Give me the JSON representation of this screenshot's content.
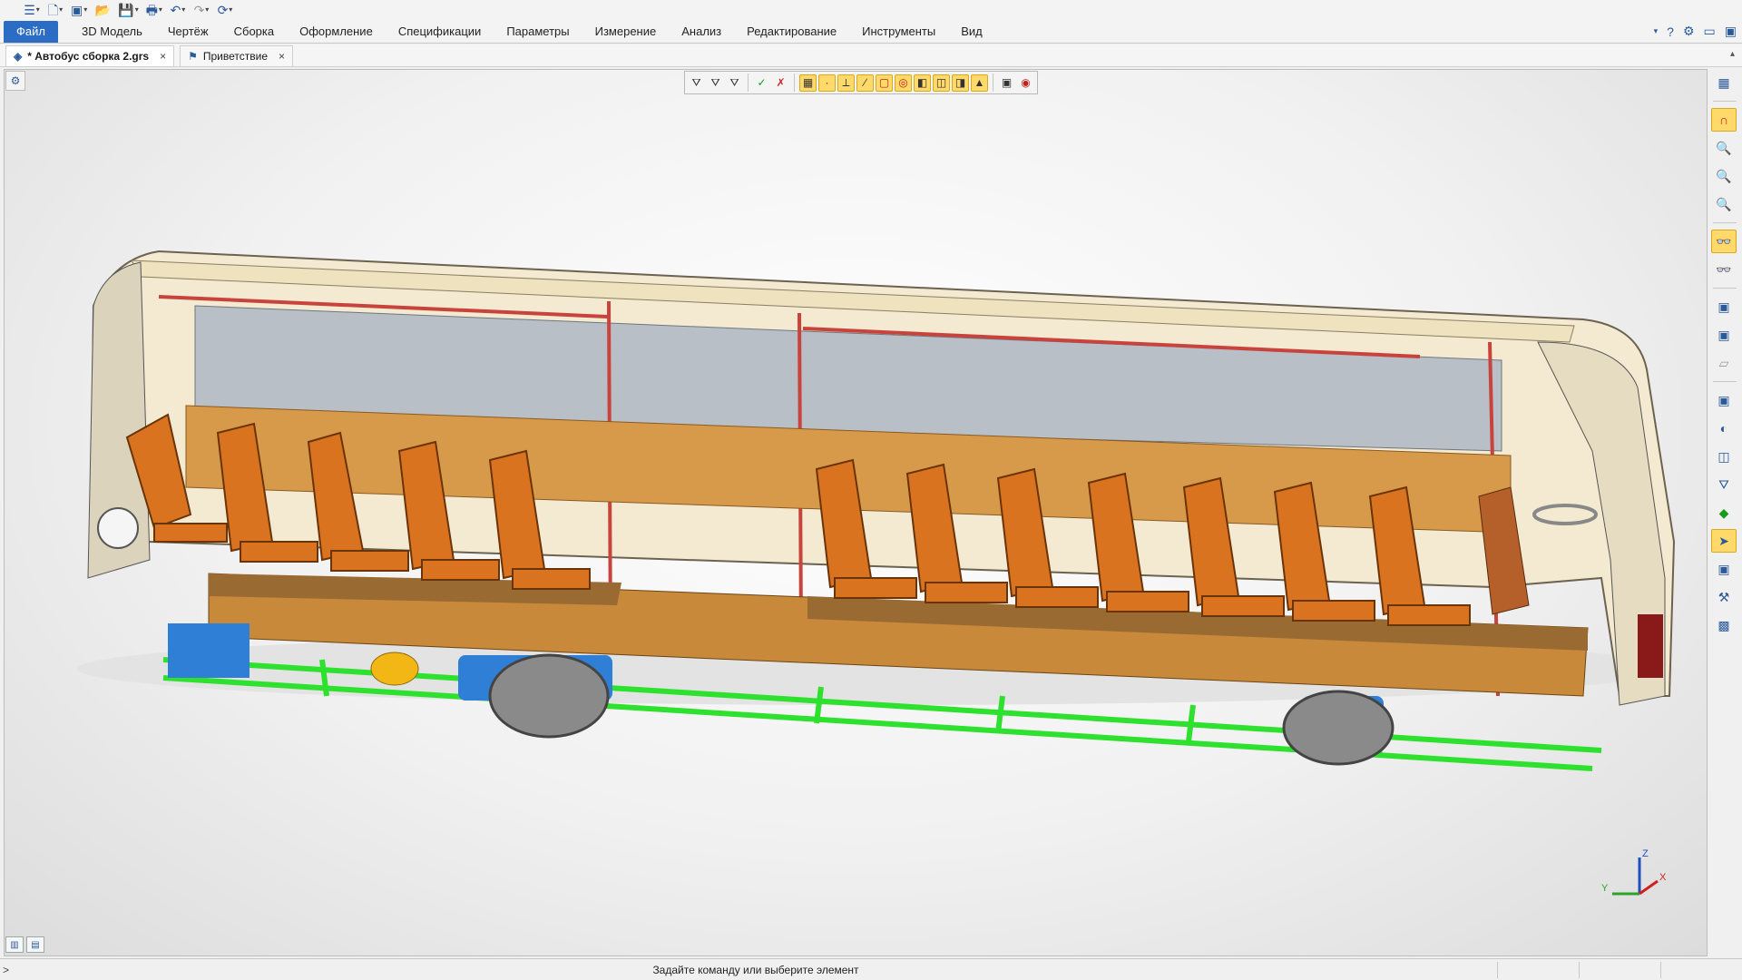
{
  "quick_access": {
    "icons": [
      "menu-icon",
      "new-document-icon",
      "new-document-dropdown",
      "model-icon",
      "open-folder-icon",
      "save-icon",
      "print-icon",
      "undo-icon",
      "redo-icon",
      "regenerate-icon"
    ]
  },
  "menu": {
    "file": "Файл",
    "items": [
      "3D Модель",
      "Чертёж",
      "Сборка",
      "Оформление",
      "Спецификации",
      "Параметры",
      "Измерение",
      "Анализ",
      "Редактирование",
      "Инструменты",
      "Вид"
    ]
  },
  "tabs": [
    {
      "label": "* Автобус сборка 2.grs",
      "close": "×",
      "active": true
    },
    {
      "label": "Приветствие",
      "close": "×",
      "active": false
    }
  ],
  "status": {
    "prompt": ">",
    "message": "Задайте команду или выберите элемент"
  },
  "axis": {
    "z": "Z",
    "y": "Y",
    "x": "X",
    "colors": {
      "z": "#1f4fbf",
      "y": "#2aa52a",
      "x": "#d02020"
    }
  },
  "colors": {
    "accent": "#2b6cc4",
    "highlight": "#ffd969",
    "frame": "#2ee12e",
    "seat": "#d9731f",
    "floor": "#c8893a",
    "chassis_blue": "#2f7fd6"
  }
}
